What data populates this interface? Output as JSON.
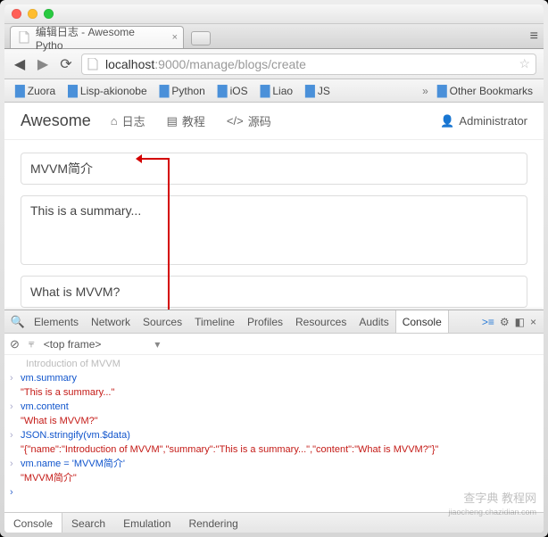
{
  "window": {
    "tab_title": "编辑日志 - Awesome Pytho"
  },
  "addressbar": {
    "scheme": "",
    "host": "localhost",
    "port": ":9000",
    "path": "/manage/blogs/create"
  },
  "bookmarks": {
    "items": [
      "Zuora",
      "Lisp-akionobe",
      "Python",
      "iOS",
      "Liao",
      "JS"
    ],
    "other": "Other Bookmarks"
  },
  "navbar": {
    "brand": "Awesome",
    "items": [
      {
        "icon": "home",
        "label": "日志"
      },
      {
        "icon": "book",
        "label": "教程"
      },
      {
        "icon": "code",
        "label": "源码"
      }
    ],
    "admin": "Administrator"
  },
  "form": {
    "name_value": "MVVM简介",
    "summary_value": "This is a summary...",
    "content_value": "What is MVVM?"
  },
  "devtools": {
    "tabs": [
      "Elements",
      "Network",
      "Sources",
      "Timeline",
      "Profiles",
      "Resources",
      "Audits",
      "Console"
    ],
    "active_tab": "Console",
    "frame_selector": "<top frame>",
    "drawer_tabs": [
      "Console",
      "Search",
      "Emulation",
      "Rendering"
    ],
    "drawer_active": "Console"
  },
  "console": {
    "lines": [
      {
        "type": "out-dim",
        "text": "  Introduction of MVVM"
      },
      {
        "type": "in",
        "text": "vm.summary"
      },
      {
        "type": "out",
        "text": "\"This is a summary...\""
      },
      {
        "type": "in",
        "text": "vm.content"
      },
      {
        "type": "out",
        "text": "\"What is MVVM?\""
      },
      {
        "type": "in",
        "text": "JSON.stringify(vm.$data)"
      },
      {
        "type": "out",
        "text": "\"{\"name\":\"Introduction of MVVM\",\"summary\":\"This is a summary...\",\"content\":\"What is MVVM?\"}\""
      },
      {
        "type": "in",
        "text": "vm.name = 'MVVM简介'"
      },
      {
        "type": "out",
        "text": "\"MVVM简介\""
      }
    ]
  },
  "watermark": {
    "line1": "查字典 教程网",
    "line2": "jiaocheng.chazidian.com"
  }
}
